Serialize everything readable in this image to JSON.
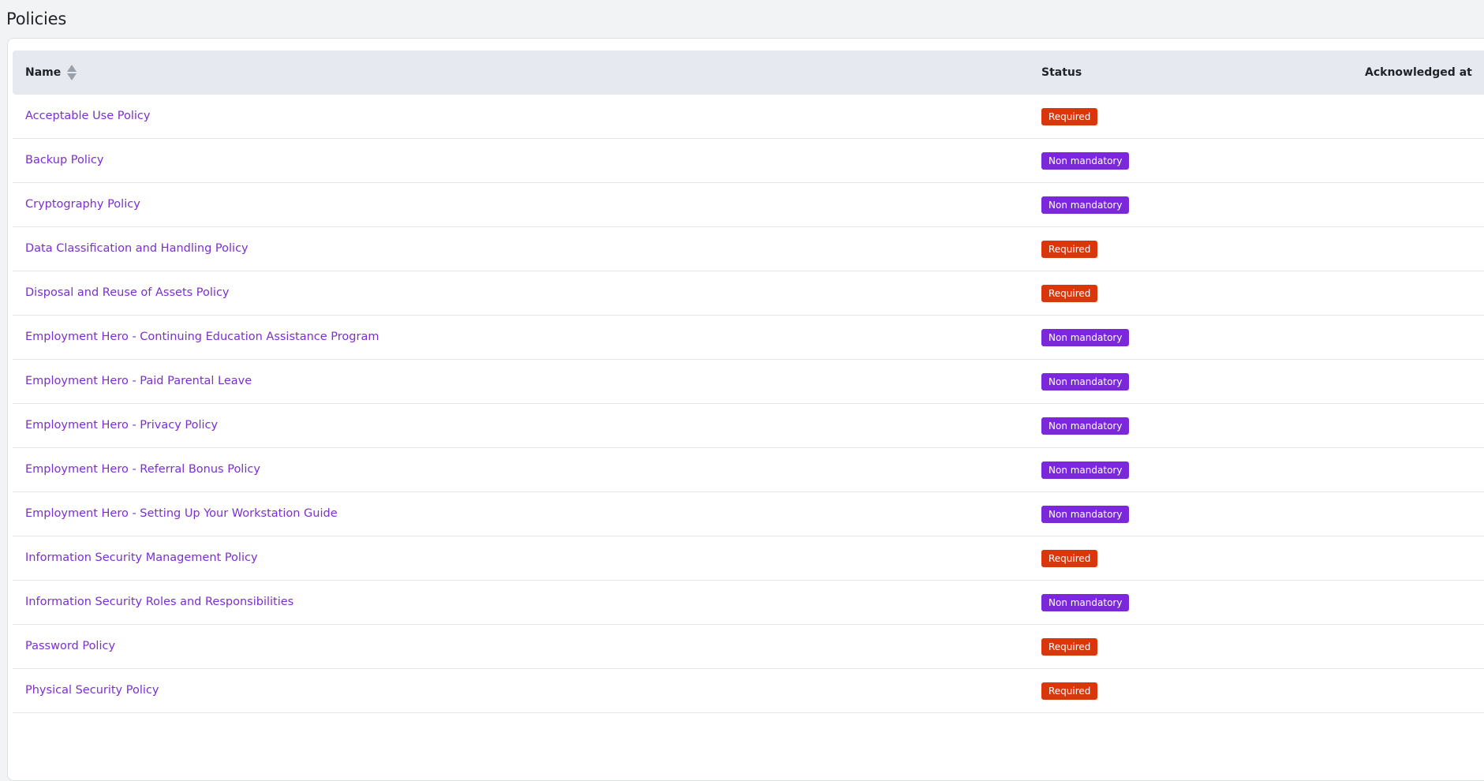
{
  "page": {
    "title": "Policies"
  },
  "table": {
    "columns": {
      "name": "Name",
      "status": "Status",
      "acknowledged_at": "Acknowledged at"
    },
    "rows": [
      {
        "name": "Acceptable Use Policy",
        "status": "Required",
        "kind": "required"
      },
      {
        "name": "Backup Policy",
        "status": "Non mandatory",
        "kind": "nonmand"
      },
      {
        "name": "Cryptography Policy",
        "status": "Non mandatory",
        "kind": "nonmand"
      },
      {
        "name": "Data Classification and Handling Policy",
        "status": "Required",
        "kind": "required"
      },
      {
        "name": "Disposal and Reuse of Assets Policy",
        "status": "Required",
        "kind": "required"
      },
      {
        "name": "Employment Hero - Continuing Education Assistance Program",
        "status": "Non mandatory",
        "kind": "nonmand"
      },
      {
        "name": "Employment Hero - Paid Parental Leave",
        "status": "Non mandatory",
        "kind": "nonmand"
      },
      {
        "name": "Employment Hero - Privacy Policy",
        "status": "Non mandatory",
        "kind": "nonmand"
      },
      {
        "name": "Employment Hero - Referral Bonus Policy",
        "status": "Non mandatory",
        "kind": "nonmand"
      },
      {
        "name": "Employment Hero - Setting Up Your Workstation Guide",
        "status": "Non mandatory",
        "kind": "nonmand"
      },
      {
        "name": "Information Security Management Policy",
        "status": "Required",
        "kind": "required"
      },
      {
        "name": "Information Security Roles and Responsibilities",
        "status": "Non mandatory",
        "kind": "nonmand"
      },
      {
        "name": "Password Policy",
        "status": "Required",
        "kind": "required"
      },
      {
        "name": "Physical Security Policy",
        "status": "Required",
        "kind": "required"
      }
    ]
  },
  "colors": {
    "link": "#7b2fd1",
    "required": "#d9360b",
    "non_mandatory": "#7a28d9",
    "header_bg": "#e6eaf0"
  }
}
